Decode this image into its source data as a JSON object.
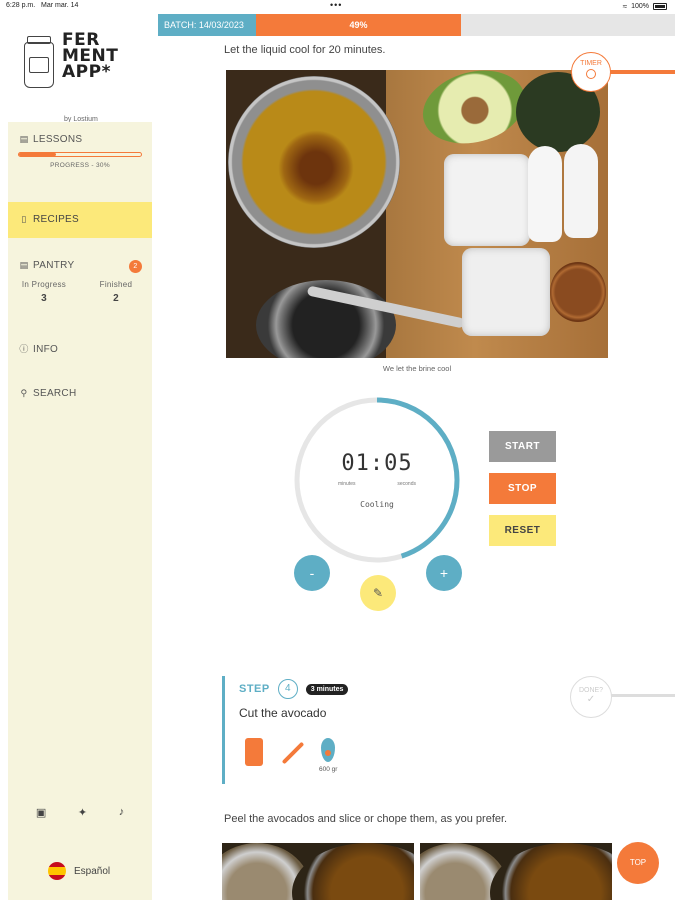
{
  "status_bar": {
    "time": "6:28 p.m.",
    "date": "Mar mar. 14",
    "dots": "•••",
    "battery": "100%"
  },
  "brand": {
    "name": "FER\nMENT\nAPP*",
    "by": "by Lostium"
  },
  "sidebar": {
    "lessons": {
      "label": "LESSONS",
      "progress_label": "PROGRESS - 30%",
      "progress": 0.3
    },
    "recipes": {
      "label": "RECIPES"
    },
    "pantry": {
      "label": "PANTRY",
      "badge": "2",
      "in_progress_label": "In Progress",
      "in_progress": "3",
      "finished_label": "Finished",
      "finished": "2"
    },
    "info": {
      "label": "INFO"
    },
    "search": {
      "label": "SEARCH"
    },
    "language": "Español"
  },
  "batch": {
    "label": "BATCH: 14/03/2023",
    "progress_label": "49%",
    "progress": 0.49
  },
  "content": {
    "intro": "Let the liquid cool for 20 minutes.",
    "timer_tag": "TIMER",
    "photo_caption": "We let the brine cool",
    "timer": {
      "display": "01:05",
      "minutes_label": "minutes",
      "seconds_label": "seconds",
      "status": "Cooling",
      "progress": 0.45
    },
    "controls": {
      "start": "START",
      "stop": "STOP",
      "reset": "RESET",
      "minus": "-",
      "plus": "+"
    },
    "step": {
      "word": "STEP",
      "number": "4",
      "duration": "3 minutes",
      "title": "Cut the avocado",
      "avocado_qty": "600 gr"
    },
    "done_tag": "DONE?",
    "next_text": "Peel the avocados and slice or chope them, as you prefer.",
    "top_button": "TOP"
  },
  "colors": {
    "accent_orange": "#f47a3a",
    "accent_blue": "#5eaec5",
    "accent_yellow": "#fce97a",
    "sidebar_bg": "#f6f4dd"
  }
}
